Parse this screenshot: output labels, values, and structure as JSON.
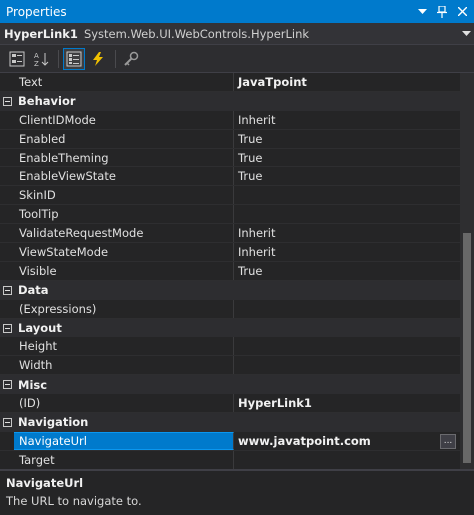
{
  "window": {
    "title": "Properties"
  },
  "object_selector": {
    "name": "HyperLink1",
    "type": "System.Web.UI.WebControls.HyperLink"
  },
  "toolbar": {
    "buttons": [
      {
        "icon": "categorized-icon",
        "active": false
      },
      {
        "icon": "alphabetical-icon",
        "active": false
      },
      {
        "icon": "properties-icon",
        "active": true
      },
      {
        "icon": "events-icon",
        "active": false
      },
      {
        "icon": "property-pages-icon",
        "active": false
      }
    ]
  },
  "rows": {
    "text": {
      "name": "Text",
      "value": "JavaTpoint"
    },
    "behavior": {
      "label": "Behavior"
    },
    "clientidmode": {
      "name": "ClientIDMode",
      "value": "Inherit"
    },
    "enabled": {
      "name": "Enabled",
      "value": "True"
    },
    "enabletheming": {
      "name": "EnableTheming",
      "value": "True"
    },
    "enableviewstate": {
      "name": "EnableViewState",
      "value": "True"
    },
    "skinid": {
      "name": "SkinID",
      "value": ""
    },
    "tooltip": {
      "name": "ToolTip",
      "value": ""
    },
    "validaterequestmode": {
      "name": "ValidateRequestMode",
      "value": "Inherit"
    },
    "viewstatemode": {
      "name": "ViewStateMode",
      "value": "Inherit"
    },
    "visible": {
      "name": "Visible",
      "value": "True"
    },
    "data": {
      "label": "Data"
    },
    "expressions": {
      "name": "(Expressions)",
      "value": ""
    },
    "layout": {
      "label": "Layout"
    },
    "height": {
      "name": "Height",
      "value": ""
    },
    "width": {
      "name": "Width",
      "value": ""
    },
    "misc": {
      "label": "Misc"
    },
    "id": {
      "name": "(ID)",
      "value": "HyperLink1"
    },
    "navigation": {
      "label": "Navigation"
    },
    "navigateurl": {
      "name": "NavigateUrl",
      "value": "www.javatpoint.com",
      "button": "..."
    },
    "target": {
      "name": "Target",
      "value": ""
    }
  },
  "description": {
    "title": "NavigateUrl",
    "text": "The URL to navigate to."
  },
  "colors": {
    "accent": "#007acc",
    "background": "#252526",
    "category": "#2d2d30"
  }
}
